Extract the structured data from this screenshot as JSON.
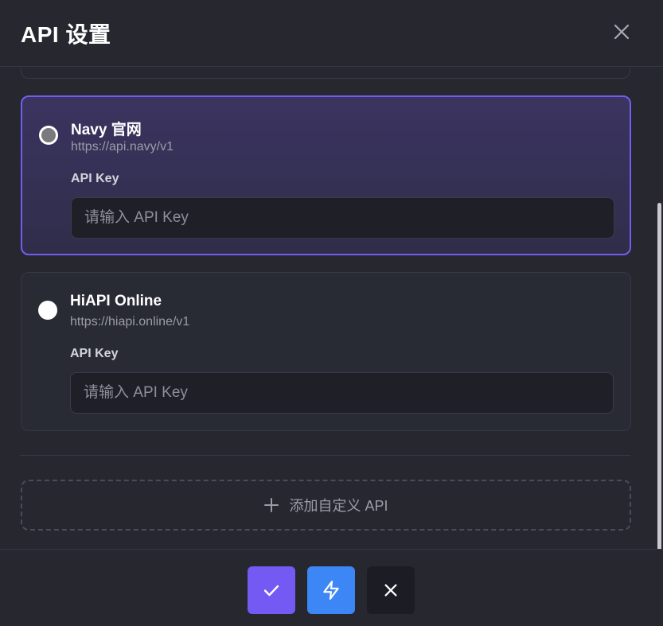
{
  "header": {
    "title": "API 设置"
  },
  "providers": [
    {
      "name": "Navy 官网",
      "url": "https://api.navy/v1",
      "key_label": "API Key",
      "key_value": "",
      "key_placeholder": "请输入 API Key",
      "selected": true
    },
    {
      "name": "HiAPI Online",
      "url": "https://hiapi.online/v1",
      "key_label": "API Key",
      "key_value": "",
      "key_placeholder": "请输入 API Key",
      "selected": false
    }
  ],
  "add_custom": {
    "label": "添加自定义 API",
    "icon": "plus-icon"
  },
  "footer": {
    "confirm_icon": "check-icon",
    "test_icon": "lightning-icon",
    "cancel_icon": "close-icon"
  },
  "colors": {
    "accent": "#6f5ff0",
    "confirm": "#7459f3",
    "test": "#3d86f5",
    "background": "#26272f"
  }
}
